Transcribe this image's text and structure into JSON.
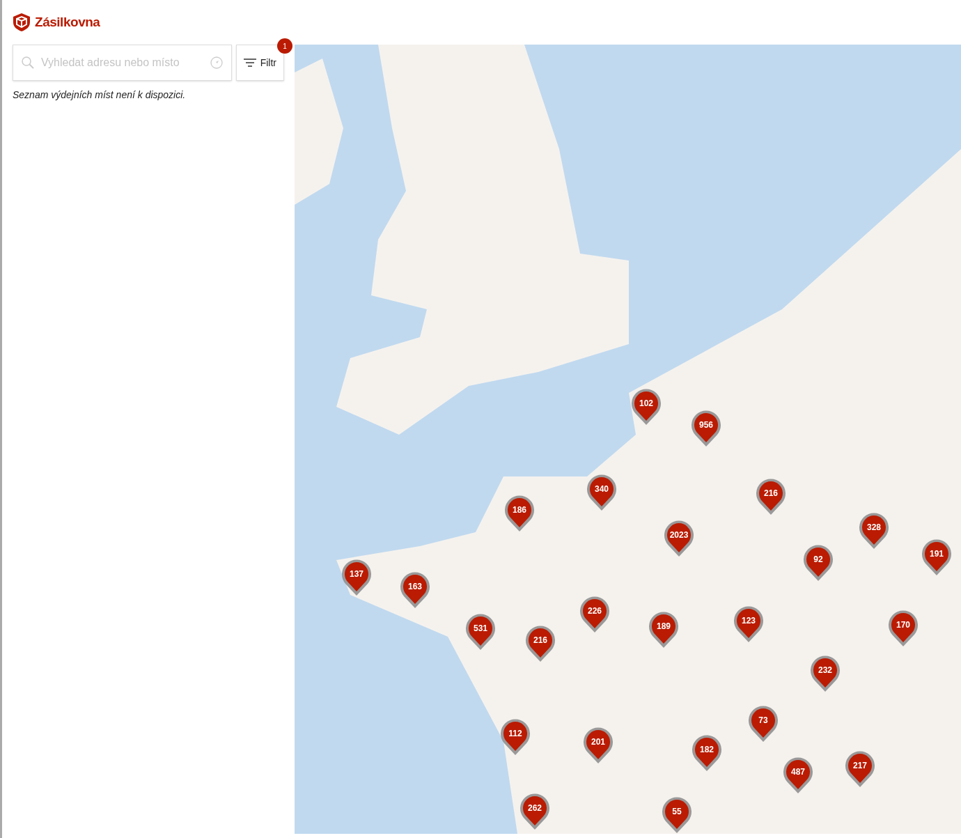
{
  "brand": {
    "name": "Zásilkovna"
  },
  "search": {
    "placeholder": "Vyhledat adresu nebo místo"
  },
  "filter_button": {
    "label": "Filtr",
    "badge": "1"
  },
  "list_message": "Seznam výdejních míst není k dispozici.",
  "map": {
    "clusters": [
      {
        "count": "102"
      },
      {
        "count": "956"
      },
      {
        "count": "340"
      },
      {
        "count": "186"
      },
      {
        "count": "216"
      },
      {
        "count": "2023"
      },
      {
        "count": "328"
      },
      {
        "count": "92"
      },
      {
        "count": "191"
      },
      {
        "count": "137"
      },
      {
        "count": "163"
      },
      {
        "count": "226"
      },
      {
        "count": "189"
      },
      {
        "count": "123"
      },
      {
        "count": "170"
      },
      {
        "count": "531"
      },
      {
        "count": "216"
      },
      {
        "count": "232"
      },
      {
        "count": "73"
      },
      {
        "count": "112"
      },
      {
        "count": "201"
      },
      {
        "count": "182"
      },
      {
        "count": "487"
      },
      {
        "count": "217"
      },
      {
        "count": "262"
      },
      {
        "count": "55"
      }
    ]
  }
}
